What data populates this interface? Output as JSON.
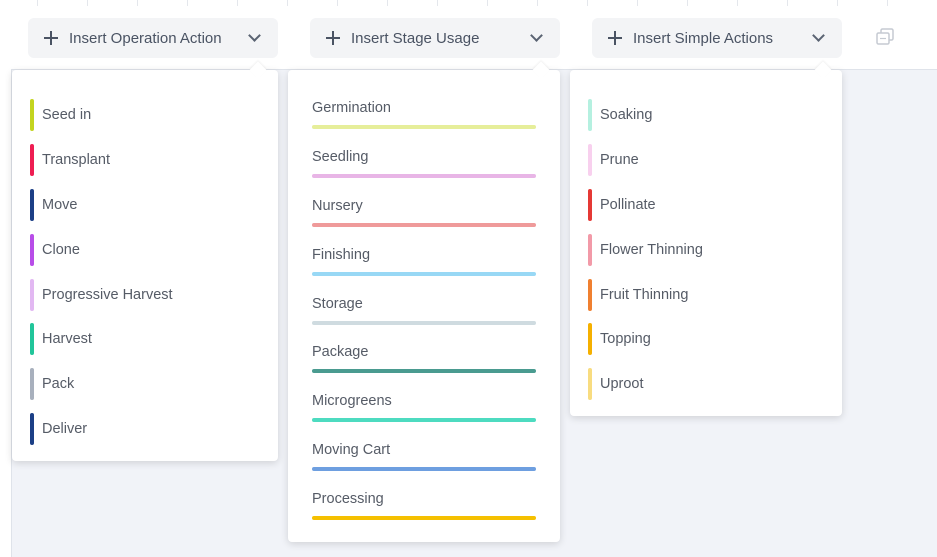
{
  "toolbar": {
    "operation_label": "Insert Operation Action",
    "stage_label": "Insert Stage Usage",
    "simple_label": "Insert Simple Actions"
  },
  "operation_actions": [
    {
      "label": "Seed in",
      "color": "#c3d41f"
    },
    {
      "label": "Transplant",
      "color": "#ee1d52"
    },
    {
      "label": "Move",
      "color": "#1c3f86"
    },
    {
      "label": "Clone",
      "color": "#b84de8"
    },
    {
      "label": "Progressive Harvest",
      "color": "#e2b8f2"
    },
    {
      "label": "Harvest",
      "color": "#21c59a"
    },
    {
      "label": "Pack",
      "color": "#a8b0bd"
    },
    {
      "label": "Deliver",
      "color": "#1c3f86"
    }
  ],
  "stage_usages": [
    {
      "label": "Germination",
      "color": "#e6ee9a"
    },
    {
      "label": "Seedling",
      "color": "#e8b5e6"
    },
    {
      "label": "Nursery",
      "color": "#ef9a9a"
    },
    {
      "label": "Finishing",
      "color": "#98d8f5"
    },
    {
      "label": "Storage",
      "color": "#cfdbe0"
    },
    {
      "label": "Package",
      "color": "#4a9b90"
    },
    {
      "label": "Microgreens",
      "color": "#4ddbc0"
    },
    {
      "label": "Moving Cart",
      "color": "#6e9fe0"
    },
    {
      "label": "Processing",
      "color": "#f5c000"
    }
  ],
  "simple_actions": [
    {
      "label": "Soaking",
      "color": "#b5f0e0"
    },
    {
      "label": "Prune",
      "color": "#f8d0ee"
    },
    {
      "label": "Pollinate",
      "color": "#e53935"
    },
    {
      "label": "Flower Thinning",
      "color": "#f29aa8"
    },
    {
      "label": "Fruit Thinning",
      "color": "#f08030"
    },
    {
      "label": "Topping",
      "color": "#f5b000"
    },
    {
      "label": "Uproot",
      "color": "#f8dc80"
    }
  ]
}
